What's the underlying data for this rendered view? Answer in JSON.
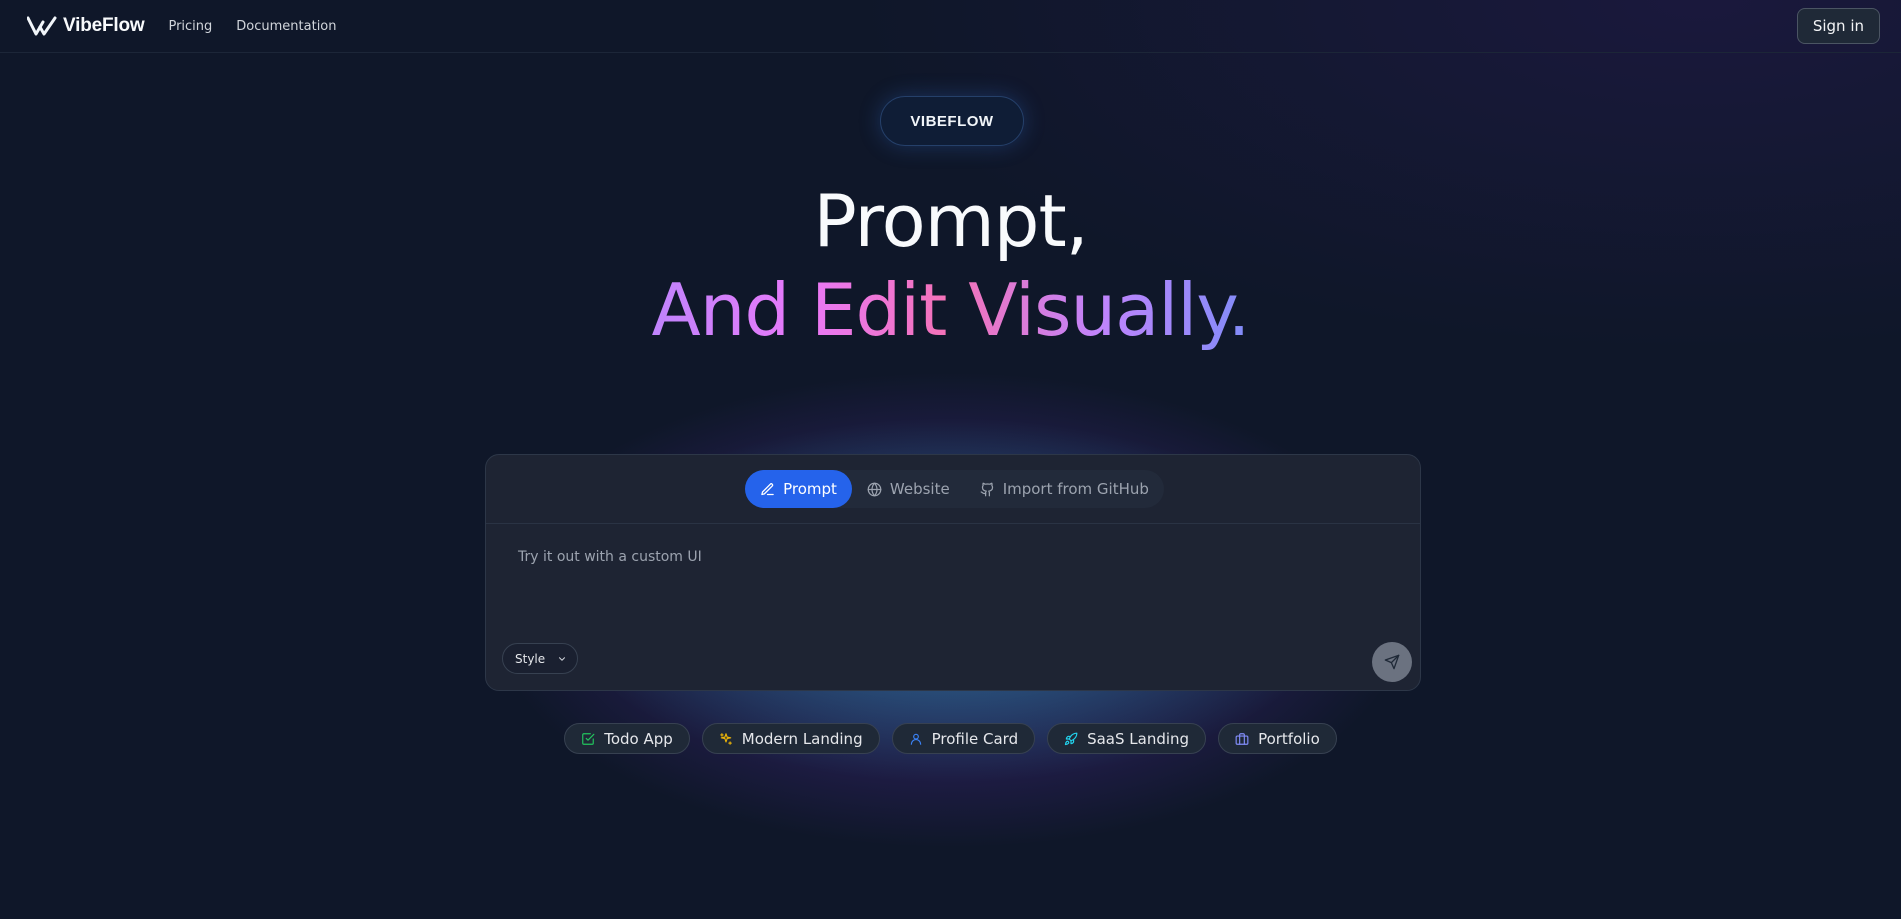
{
  "header": {
    "brand": "VibeFlow",
    "nav": [
      "Pricing",
      "Documentation"
    ],
    "signin_label": "Sign in"
  },
  "hero": {
    "badge": "VIBEFLOW",
    "headline_line1": "Prompt,",
    "headline_line2": "And Edit Visually."
  },
  "panel": {
    "tabs": [
      {
        "label": "Prompt",
        "icon": "pencil-icon",
        "active": true
      },
      {
        "label": "Website",
        "icon": "globe-icon",
        "active": false
      },
      {
        "label": "Import from GitHub",
        "icon": "github-icon",
        "active": false
      }
    ],
    "prompt_text": "Try it out with a custom UI",
    "style_label": "Style",
    "send_icon": "send-icon"
  },
  "chips": [
    {
      "label": "Todo App",
      "icon": "checkbox-icon",
      "color": "#22c55e"
    },
    {
      "label": "Modern Landing",
      "icon": "sparkles-icon",
      "color": "#eab308"
    },
    {
      "label": "Profile Card",
      "icon": "user-icon",
      "color": "#3b82f6"
    },
    {
      "label": "SaaS Landing",
      "icon": "rocket-icon",
      "color": "#22d3ee"
    },
    {
      "label": "Portfolio",
      "icon": "briefcase-icon",
      "color": "#818cf8"
    }
  ],
  "colors": {
    "background": "#0f1729",
    "accent": "#2563eb",
    "gradient_start": "#c084fc",
    "gradient_mid": "#f472b6",
    "gradient_end": "#818cf8"
  }
}
